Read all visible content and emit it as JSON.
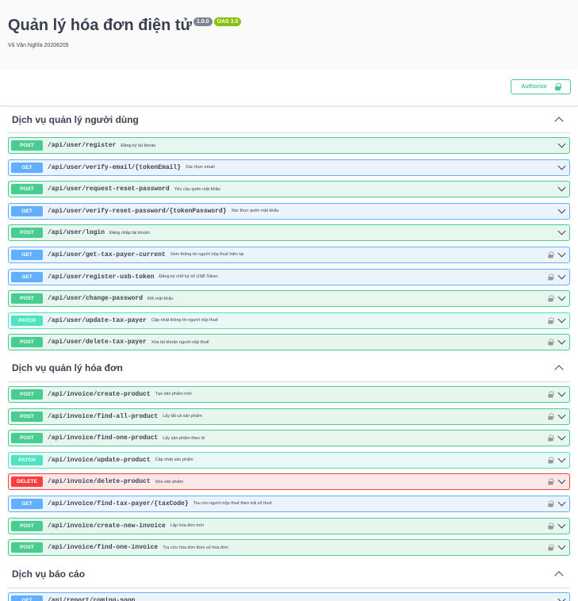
{
  "info": {
    "title": "Quản lý hóa đơn điện tử",
    "version": "1.0.0",
    "oas": "OAS 3.0",
    "subtitle": "Vũ Văn Nghĩa 20206205"
  },
  "authorize_label": "Authorize",
  "colors": {
    "post": "#49cc90",
    "get": "#61affe",
    "patch": "#50e3c2",
    "delete": "#f93e3e"
  },
  "groups": [
    {
      "name": "Dịch vụ quản lý người dùng",
      "ops": [
        {
          "method": "POST",
          "path": "/api/user/register",
          "desc": "Đăng ký tài khoản",
          "locked": false
        },
        {
          "method": "GET",
          "path": "/api/user/verify-email/{tokenEmail}",
          "desc": "Xác thực email",
          "locked": false
        },
        {
          "method": "POST",
          "path": "/api/user/request-reset-password",
          "desc": "Yêu cầu quên mật khẩu",
          "locked": false
        },
        {
          "method": "GET",
          "path": "/api/user/verify-reset-password/{tokenPassword}",
          "desc": "Xác thực quên mật khẩu",
          "locked": false
        },
        {
          "method": "POST",
          "path": "/api/user/login",
          "desc": "Đăng nhập tài khoản",
          "locked": false
        },
        {
          "method": "GET",
          "path": "/api/user/get-tax-payer-current",
          "desc": "Xem thông tin người nộp thuế hiện tại",
          "locked": true
        },
        {
          "method": "GET",
          "path": "/api/user/register-usb-token",
          "desc": "Đăng ký chữ ký số USB Token",
          "locked": true
        },
        {
          "method": "POST",
          "path": "/api/user/change-password",
          "desc": "Đổi mật khẩu",
          "locked": true
        },
        {
          "method": "PATCH",
          "path": "/api/user/update-tax-payer",
          "desc": "Cập nhật thông tin người nộp thuế",
          "locked": true
        },
        {
          "method": "POST",
          "path": "/api/user/delete-tax-payer",
          "desc": "Xóa tài khoản người nộp thuế",
          "locked": true
        }
      ]
    },
    {
      "name": "Dịch vụ quản lý hóa đơn",
      "ops": [
        {
          "method": "POST",
          "path": "/api/invoice/create-product",
          "desc": "Tạo sản phẩm mới",
          "locked": true
        },
        {
          "method": "POST",
          "path": "/api/invoice/find-all-product",
          "desc": "Lấy tất cả sản phẩm",
          "locked": true
        },
        {
          "method": "POST",
          "path": "/api/invoice/find-one-product",
          "desc": "Lấy sản phẩm theo id",
          "locked": true
        },
        {
          "method": "PATCH",
          "path": "/api/invoice/update-product",
          "desc": "Cập nhật sản phẩm",
          "locked": true
        },
        {
          "method": "DELETE",
          "path": "/api/invoice/delete-product",
          "desc": "Xóa sản phẩm",
          "locked": true
        },
        {
          "method": "GET",
          "path": "/api/invoice/find-tax-payer/{taxCode}",
          "desc": "Tra cứu người nộp thuế theo mã số thuế",
          "locked": true
        },
        {
          "method": "POST",
          "path": "/api/invoice/create-new-invoice",
          "desc": "Lập hóa đơn mới",
          "locked": true
        },
        {
          "method": "POST",
          "path": "/api/invoice/find-one-invoice",
          "desc": "Tra cứu hóa đơn theo số hóa đơn",
          "locked": true
        }
      ]
    },
    {
      "name": "Dịch vụ báo cáo",
      "ops": [
        {
          "method": "GET",
          "path": "/api/report/coming-soon",
          "desc": "",
          "locked": false
        }
      ]
    }
  ]
}
